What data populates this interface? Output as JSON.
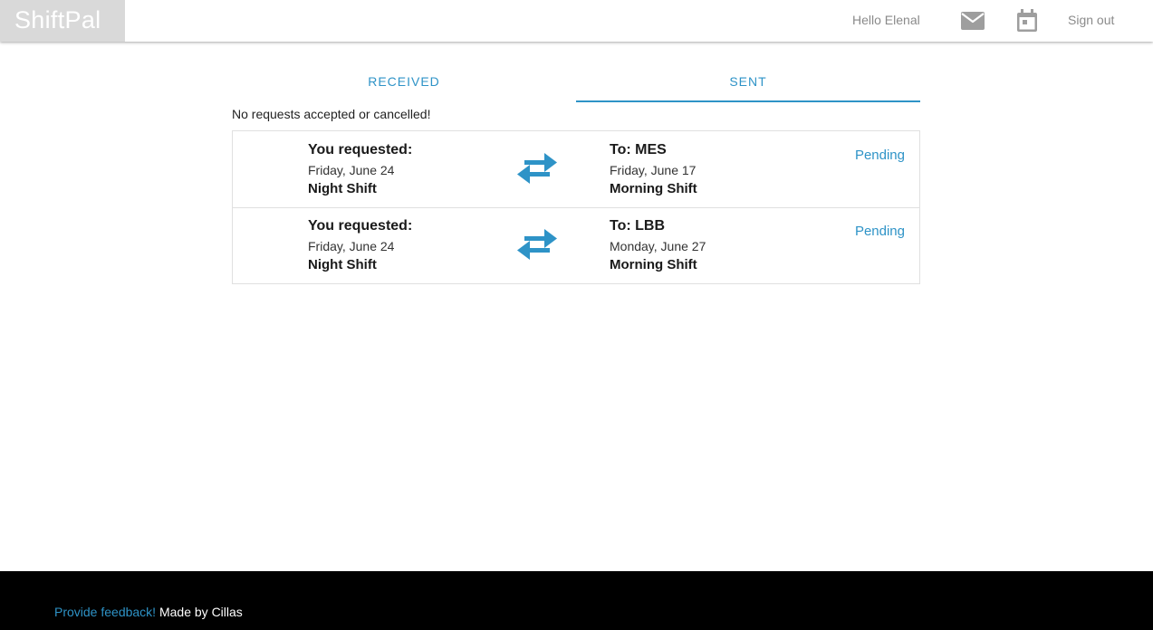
{
  "app": {
    "logo": "ShiftPal"
  },
  "header": {
    "greeting": "Hello Elenal",
    "mail_icon": "mail-icon",
    "calendar_icon": "calendar-icon",
    "signout_label": "Sign out"
  },
  "tabs": [
    {
      "label": "RECEIVED",
      "active": false
    },
    {
      "label": "SENT",
      "active": true
    }
  ],
  "notice": "No requests accepted or cancelled!",
  "requests": [
    {
      "from_heading": "You requested:",
      "from_date": "Friday, June 24",
      "from_shift": "Night Shift",
      "to_heading": "To: MES",
      "to_date": "Friday, June 17",
      "to_shift": "Morning Shift",
      "status": "Pending",
      "icon": "swap-arrows-icon"
    },
    {
      "from_heading": "You requested:",
      "from_date": "Friday, June 24",
      "from_shift": "Night Shift",
      "to_heading": "To: LBB",
      "to_date": "Monday, June 27",
      "to_shift": "Morning Shift",
      "status": "Pending",
      "icon": "swap-arrows-icon"
    }
  ],
  "footer": {
    "feedback_label": "Provide feedback!",
    "made_by_label": " Made by ",
    "author": "Cillas"
  },
  "colors": {
    "accent": "#2e93c7",
    "logo_bg": "#d9d9d9",
    "footer_bg": "#000000",
    "muted_text": "#8a8a8a"
  }
}
